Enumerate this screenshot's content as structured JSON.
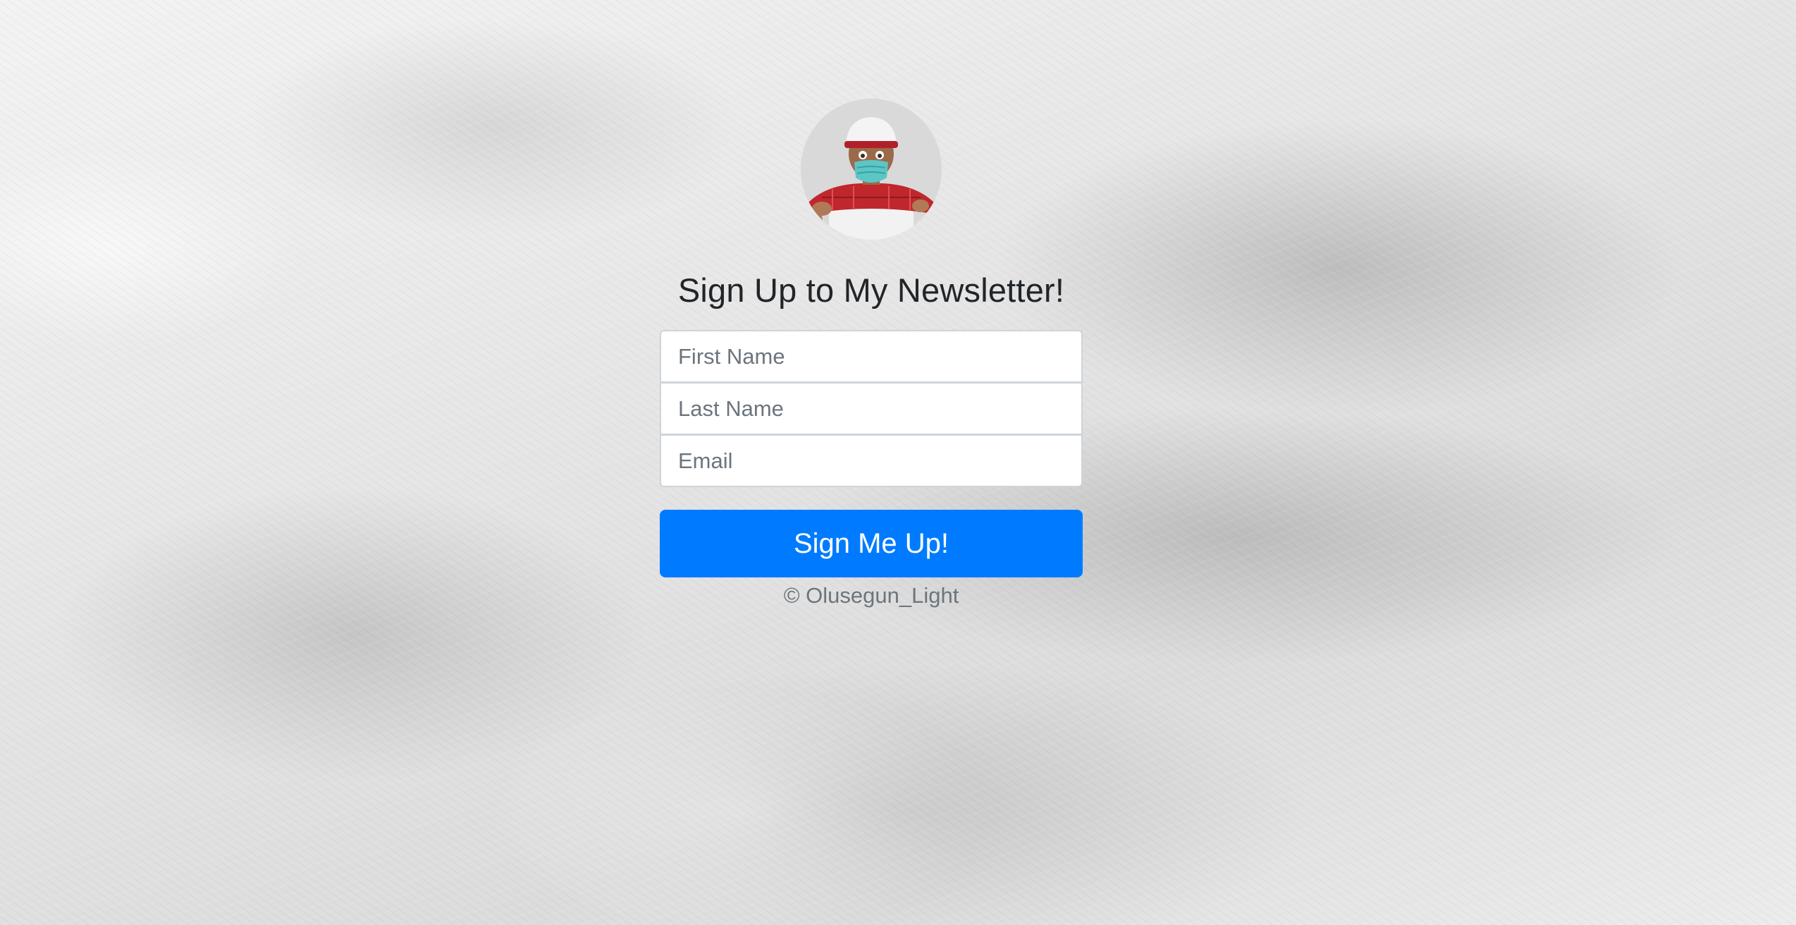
{
  "page": {
    "background": "grey concrete texture"
  },
  "avatar": {
    "icon": "masked-cartoon-avatar-icon",
    "colors": {
      "cap": "#f4f4f4",
      "shirt": "#c0272d",
      "mask": "#5cc6c6",
      "skin": "#9b6a4a"
    }
  },
  "heading": {
    "text": "Sign Up to My Newsletter!"
  },
  "form": {
    "first_name": {
      "placeholder": "First Name",
      "value": ""
    },
    "last_name": {
      "placeholder": "Last Name",
      "value": ""
    },
    "email": {
      "placeholder": "Email",
      "value": ""
    },
    "submit_label": "Sign Me Up!",
    "submit_color": "#007bff"
  },
  "footer": {
    "copyright": "© Olusegun_Light"
  }
}
